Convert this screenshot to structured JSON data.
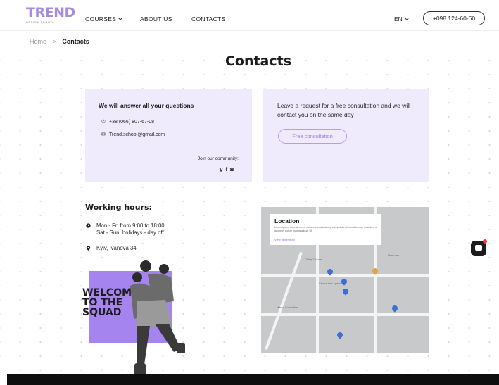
{
  "header": {
    "logo_main": "TREND",
    "logo_sub": "DESIGN SCHOOL",
    "nav": [
      {
        "label": "COURSES"
      },
      {
        "label": "ABOUT US"
      },
      {
        "label": "CONTACTS"
      }
    ],
    "language": "EN",
    "phone_button": "+098 124-60-60"
  },
  "breadcrumb": {
    "home": "Home",
    "separator": ">",
    "current": "Contacts"
  },
  "page_title": "Contacts",
  "contact_card": {
    "title": "We will answer all your questions",
    "phone": "+38 (066) 807-67-08",
    "email": "Trend.school@gmail.com",
    "community_label": "Join our community:",
    "social_icons": [
      "twitter-icon",
      "facebook-icon",
      "instagram-icon"
    ]
  },
  "request_card": {
    "text": "Leave a request for a free consultation and we will contact you on the same day",
    "button": "Free consultation"
  },
  "working_hours": {
    "title": "Working hours:",
    "weekdays": "Mon - Fri from 9:00 to 18:00",
    "weekend": "Sat - Sun, holidays - day off",
    "address": "Kyiv, Ivanova 34"
  },
  "promo": {
    "text": "WELCOME\nTO THE\nSQUAD"
  },
  "map": {
    "location_title": "Location",
    "location_desc": "Lorem ipsum dolor sit amet, consectetur adipiscing elit, sed do eiusmod tempor incididunt ut labore et dolore magna aliqua. Ut",
    "view_larger": "View larger map",
    "labels": [
      "Chilay Donna",
      "Sauna and Agenzia",
      "Marco Contrattori",
      "Maximus"
    ]
  },
  "colors": {
    "accent": "#a58ce0",
    "card_bg": "#efeafc",
    "promo_bg": "#a684f0",
    "button_border": "#b59cf0"
  }
}
